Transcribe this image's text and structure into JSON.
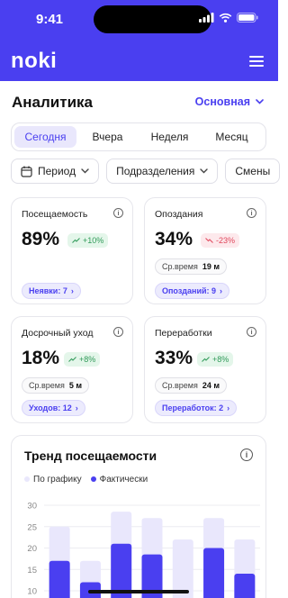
{
  "status": {
    "time": "9:41"
  },
  "header": {
    "logo": "noki"
  },
  "page": {
    "title": "Аналитика",
    "dropdown_label": "Основная"
  },
  "tabs": [
    "Сегодня",
    "Вчера",
    "Неделя",
    "Месяц"
  ],
  "active_tab": 0,
  "filters": {
    "period": "Период",
    "divisions": "Подразделения",
    "shifts": "Смены"
  },
  "cards": {
    "attendance": {
      "title": "Посещаемость",
      "value": "89%",
      "delta": "+10%",
      "link": "Неявки: 7"
    },
    "lateness": {
      "title": "Опоздания",
      "value": "34%",
      "delta": "-23%",
      "avg_label": "Ср.время",
      "avg_value": "19 м",
      "link": "Опозданий: 9"
    },
    "early_leave": {
      "title": "Досрочный уход",
      "value": "18%",
      "delta": "+8%",
      "avg_label": "Ср.время",
      "avg_value": "5 м",
      "link": "Уходов: 12"
    },
    "overtime": {
      "title": "Переработки",
      "value": "33%",
      "delta": "+8%",
      "avg_label": "Ср.время",
      "avg_value": "24 м",
      "link": "Переработок: 2"
    }
  },
  "trend": {
    "title": "Тренд посещаемости",
    "legend_plan": "По графику",
    "legend_fact": "Фактически"
  },
  "chart_data": {
    "type": "bar",
    "ylim": [
      0,
      30
    ],
    "yticks": [
      10,
      15,
      20,
      25,
      30
    ],
    "series": [
      {
        "name": "По графику",
        "values": [
          25,
          17,
          28.5,
          27,
          22,
          27,
          22
        ]
      },
      {
        "name": "Фактически",
        "values": [
          17,
          12,
          21,
          18.5,
          0,
          20,
          14
        ]
      }
    ]
  },
  "colors": {
    "accent": "#4a3ff0",
    "plan": "#e9e7fc",
    "fact": "#4a3ff0",
    "up": "#2f9a58",
    "down": "#e0475c"
  }
}
